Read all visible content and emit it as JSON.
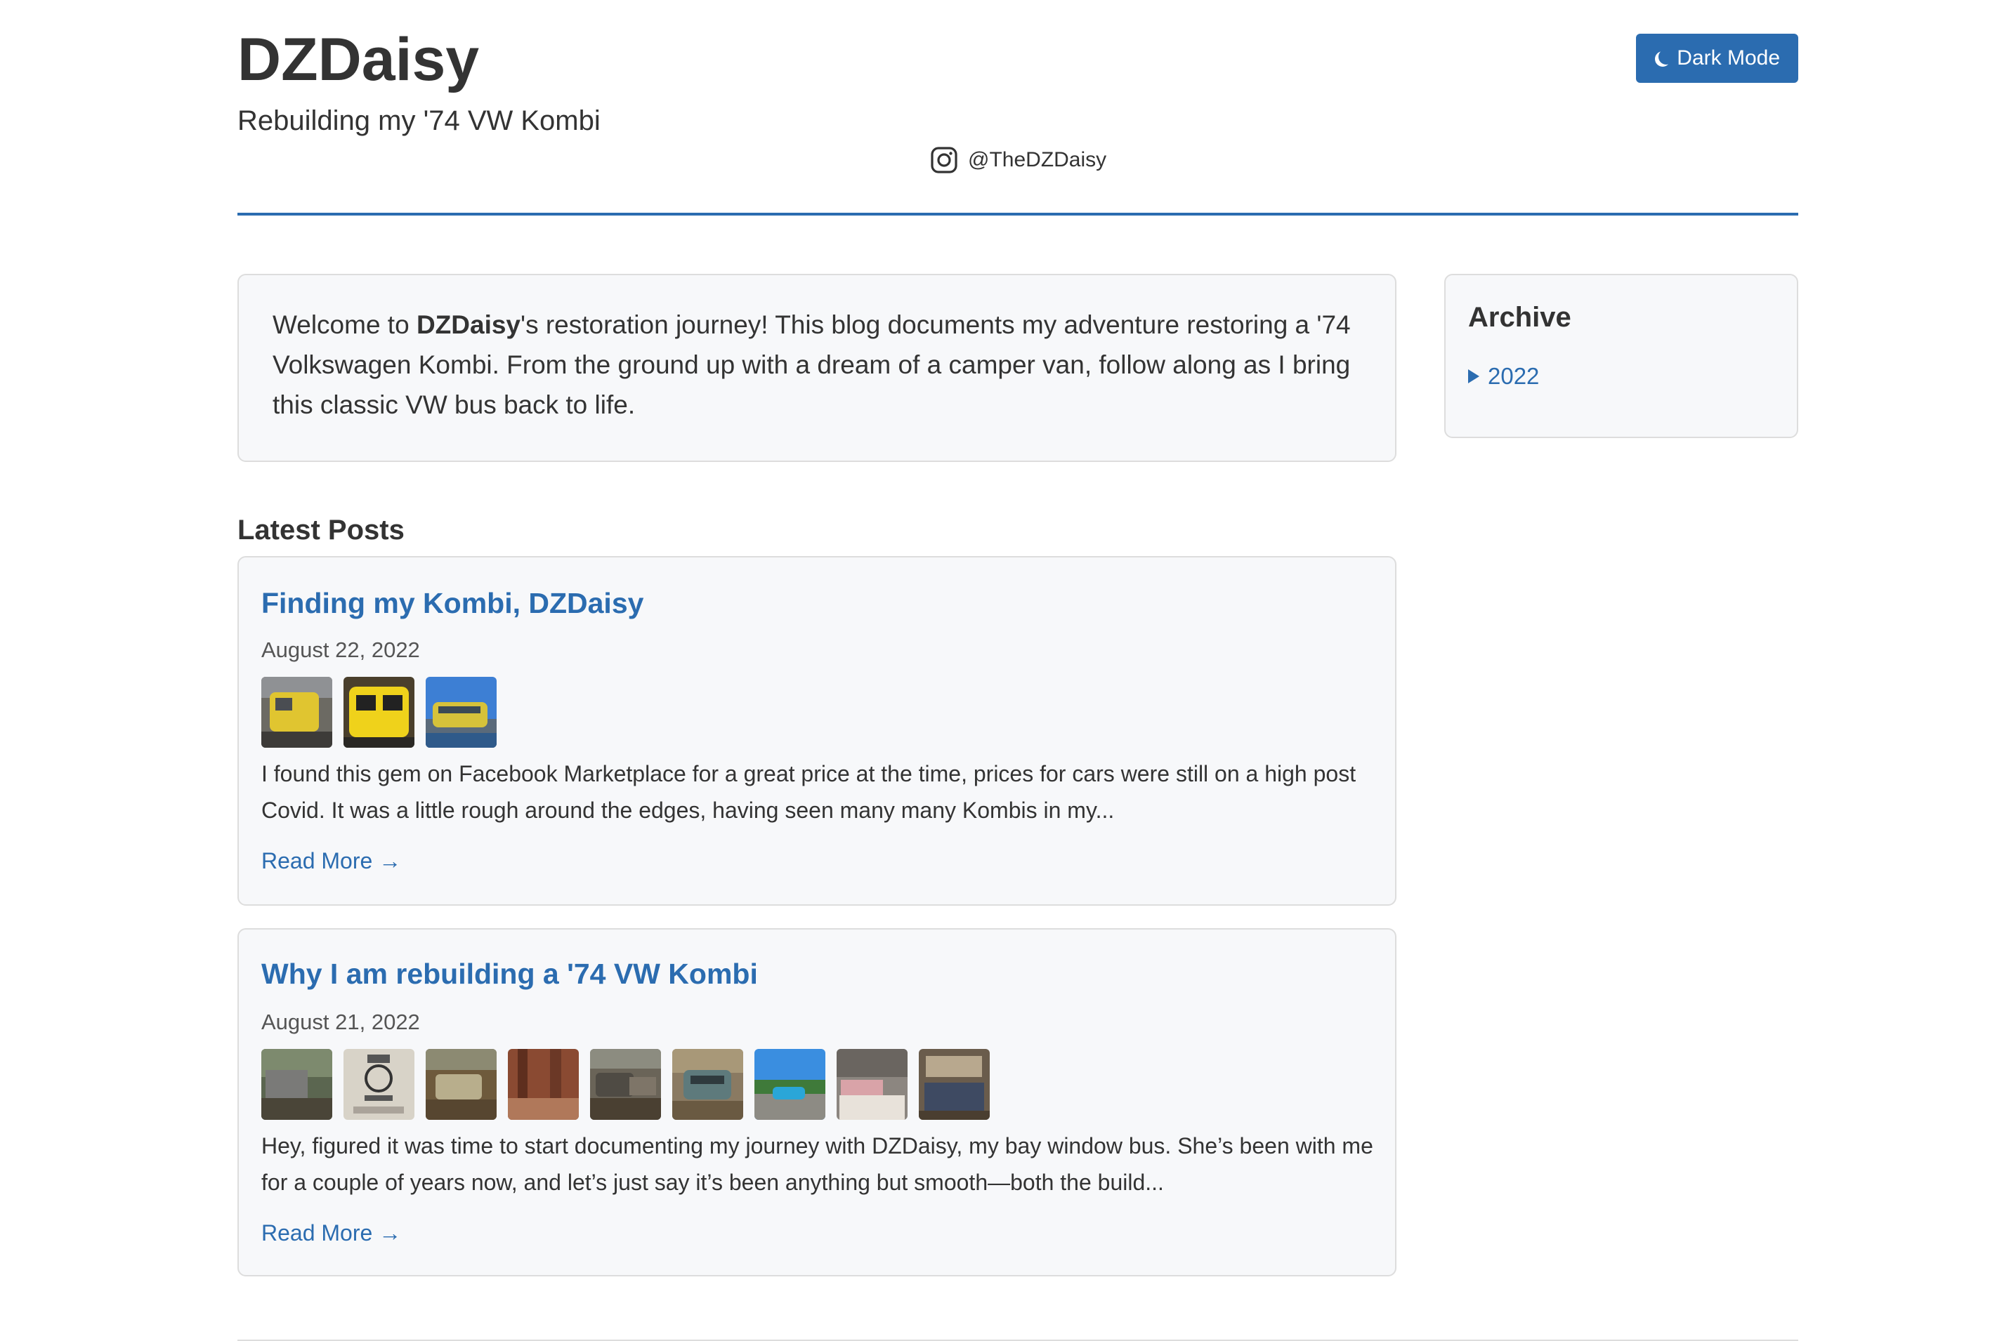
{
  "header": {
    "title": "DZDaisy",
    "subtitle": "Rebuilding my '74 VW Kombi",
    "dark_mode_label": "Dark Mode",
    "instagram_handle": "@TheDZDaisy"
  },
  "intro": {
    "prefix": "Welcome to ",
    "bold": "DZDaisy",
    "suffix": "'s restoration journey! This blog documents my adventure restoring a '74 Volkswagen Kombi. From the ground up with a dream of a camper van, follow along as I bring this classic VW bus back to life."
  },
  "archive": {
    "heading": "Archive",
    "years": [
      "2022"
    ]
  },
  "latest_heading": "Latest Posts",
  "posts": [
    {
      "title": "Finding my Kombi, DZDaisy",
      "date": "August 22, 2022",
      "excerpt": "I found this gem on Facebook Marketplace for a great price at the time, prices for cars were still on a high post Covid. It was a little rough around the edges, having seen many many Kombis in my...",
      "read_more": "Read More →",
      "thumb_count": 3
    },
    {
      "title": "Why I am rebuilding a '74 VW Kombi",
      "date": "August 21, 2022",
      "excerpt": "Hey, figured it was time to start documenting my journey with DZDaisy, my bay window bus. She’s been with me for a couple of years now, and let’s just say it’s been anything but smooth—both the build...",
      "read_more": "Read More →",
      "thumb_count": 9
    }
  ],
  "colors": {
    "accent": "#2b6cb0",
    "card_bg": "#f7f8fa",
    "border": "#dddddd",
    "text": "#333333"
  }
}
